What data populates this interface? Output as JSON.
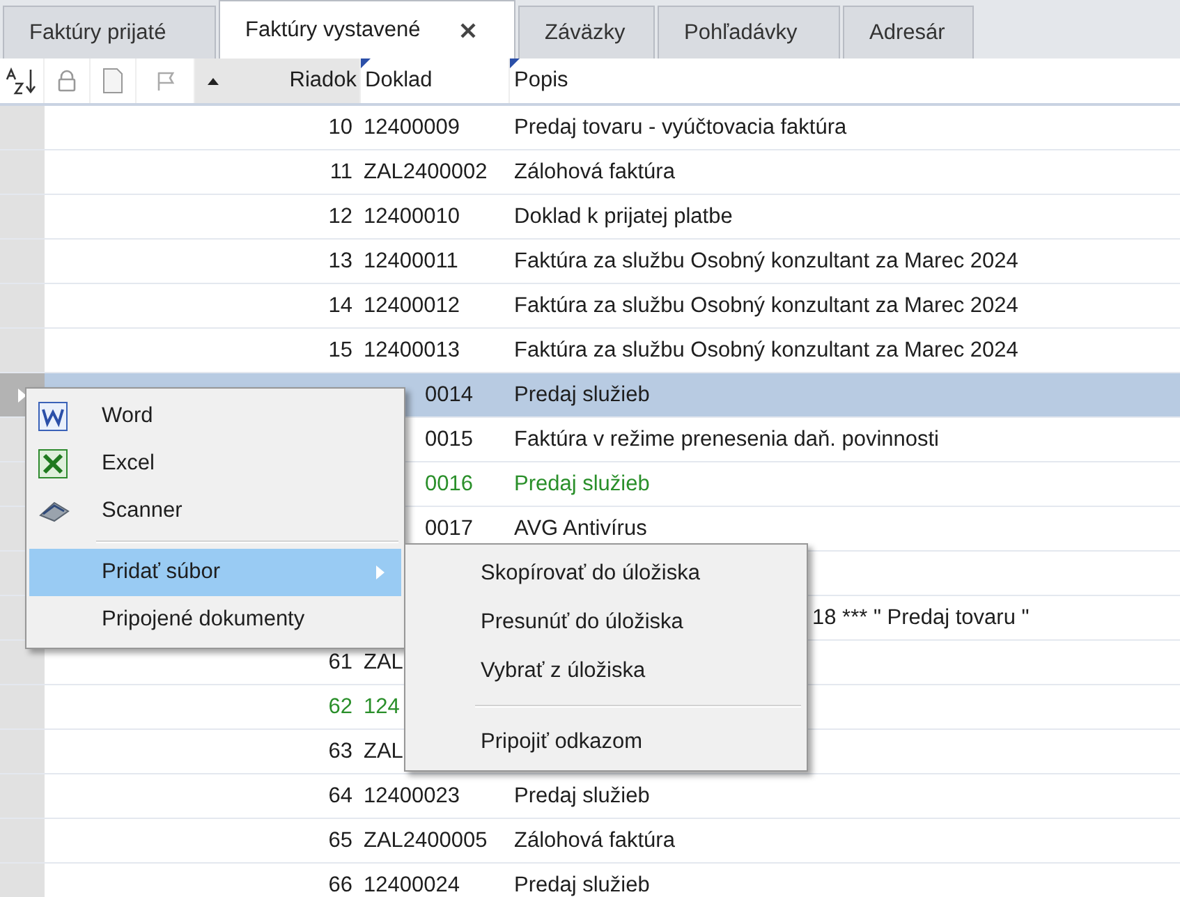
{
  "tabs": [
    {
      "label": "Faktúry prijaté",
      "selected": false
    },
    {
      "label": "Faktúry vystavené",
      "selected": true
    },
    {
      "label": "Záväzky",
      "selected": false
    },
    {
      "label": "Pohľadávky",
      "selected": false
    },
    {
      "label": "Adresár",
      "selected": false
    }
  ],
  "table": {
    "columns": [
      "Riadok",
      "Doklad",
      "Popis"
    ],
    "rows": [
      {
        "riadok": "10",
        "doklad": "12400009",
        "popis": "Predaj tovaru - vyúčtovacia faktúra",
        "selected": false,
        "color": "#1e1e1e"
      },
      {
        "riadok": "11",
        "doklad": "ZAL2400002",
        "popis": "Zálohová faktúra",
        "selected": false,
        "color": "#1e1e1e"
      },
      {
        "riadok": "12",
        "doklad": "12400010",
        "popis": "Doklad k prijatej platbe",
        "selected": false,
        "color": "#1e1e1e"
      },
      {
        "riadok": "13",
        "doklad": "12400011",
        "popis": "Faktúra za službu Osobný konzultant za Marec 2024",
        "selected": false,
        "color": "#1e1e1e"
      },
      {
        "riadok": "14",
        "doklad": "12400012",
        "popis": "Faktúra za službu Osobný konzultant za Marec 2024",
        "selected": false,
        "color": "#1e1e1e"
      },
      {
        "riadok": "15",
        "doklad": "12400013",
        "popis": "Faktúra za službu Osobný konzultant za Marec 2024",
        "selected": false,
        "color": "#1e1e1e"
      },
      {
        "doklad": "0014",
        "popis": "Predaj služieb",
        "selected": true,
        "color": "#1e1e1e"
      },
      {
        "doklad": "0015",
        "popis": "Faktúra v režime prenesenia daň. povinnosti",
        "selected": false,
        "color": "#1e1e1e"
      },
      {
        "doklad": "0016",
        "popis": "Predaj služieb",
        "selected": false,
        "color": "#2a8f2a"
      },
      {
        "doklad": "0017",
        "popis": "AVG Antivírus",
        "selected": false,
        "color": "#1e1e1e"
      },
      {
        "selected": false
      },
      {
        "popis": "18 *** \" Predaj tovaru \"",
        "selected": false,
        "color": "#1e1e1e"
      },
      {
        "riadok": "61",
        "doklad": "ZAL",
        "selected": false,
        "color": "#1e1e1e"
      },
      {
        "riadok": "62",
        "doklad": "124",
        "selected": false,
        "color": "#2a8f2a"
      },
      {
        "riadok": "63",
        "doklad": "ZAL",
        "selected": false,
        "color": "#1e1e1e"
      },
      {
        "riadok": "64",
        "doklad": "12400023",
        "popis": "Predaj služieb",
        "selected": false,
        "color": "#1e1e1e"
      },
      {
        "riadok": "65",
        "doklad": "ZAL2400005",
        "popis": "Zálohová faktúra",
        "selected": false,
        "color": "#1e1e1e"
      },
      {
        "riadok": "66",
        "doklad": "12400024",
        "popis": "Predaj služieb",
        "selected": false,
        "color": "#1e1e1e"
      }
    ]
  },
  "context_menu": {
    "items": [
      {
        "kind": "item",
        "label": "Word",
        "selected": false
      },
      {
        "kind": "item",
        "label": "Excel",
        "selected": false
      },
      {
        "kind": "item",
        "label": "Scanner",
        "selected": false
      },
      {
        "kind": "separator"
      },
      {
        "kind": "submenu",
        "label": "Pridať súbor",
        "selected": true
      },
      {
        "kind": "item",
        "label": "Pripojené dokumenty",
        "selected": false
      }
    ]
  },
  "submenu": {
    "items": [
      {
        "kind": "item",
        "label": "Skopírovať do úložiska",
        "selected": false
      },
      {
        "kind": "item",
        "label": "Presunúť do úložiska",
        "selected": false
      },
      {
        "kind": "item",
        "label": "Vybrať z úložiska",
        "selected": false
      },
      {
        "kind": "separator"
      },
      {
        "kind": "item",
        "label": "Pripojiť odkazom",
        "selected": false
      }
    ]
  }
}
